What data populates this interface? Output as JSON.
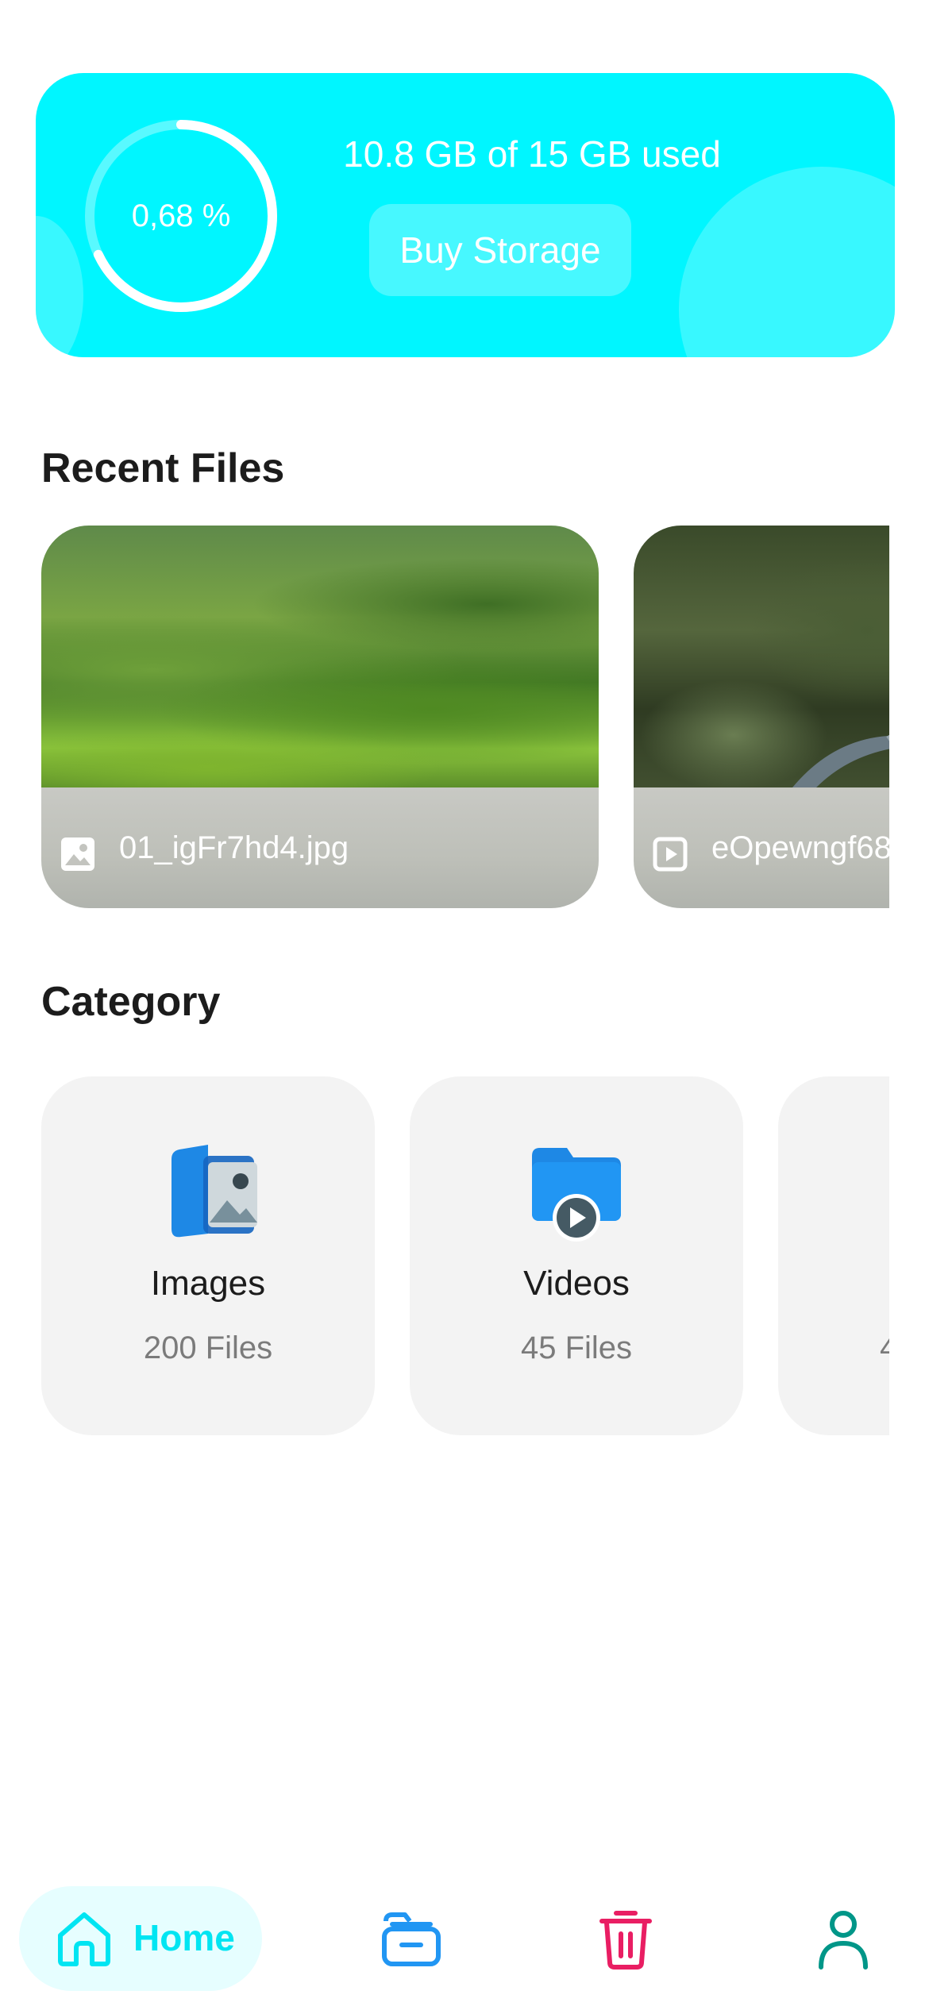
{
  "storage": {
    "percent_label": "0,68 %",
    "percent_value": 0.68,
    "usage_text": "10.8 GB of 15 GB used",
    "buy_button": "Buy Storage"
  },
  "recent_files": {
    "title": "Recent Files",
    "items": [
      {
        "name": "01_igFr7hd4.jpg",
        "type_icon": "image-file-icon"
      },
      {
        "name": "eOpewngf68",
        "type_icon": "video-file-icon"
      }
    ]
  },
  "category": {
    "title": "Category",
    "items": [
      {
        "name": "Images",
        "count": "200 Files",
        "icon": "images-category-icon"
      },
      {
        "name": "Videos",
        "count": "45 Files",
        "icon": "videos-category-icon"
      },
      {
        "name": "",
        "count": "4",
        "icon": ""
      }
    ]
  },
  "bottom_nav": {
    "home_label": "Home",
    "items": [
      "home-icon",
      "folder-icon",
      "trash-icon",
      "profile-icon"
    ]
  },
  "colors": {
    "accent": "#00f6ff",
    "home_active": "#00e5f2",
    "folder": "#2196f3",
    "trash": "#e91e63",
    "profile": "#009688"
  }
}
